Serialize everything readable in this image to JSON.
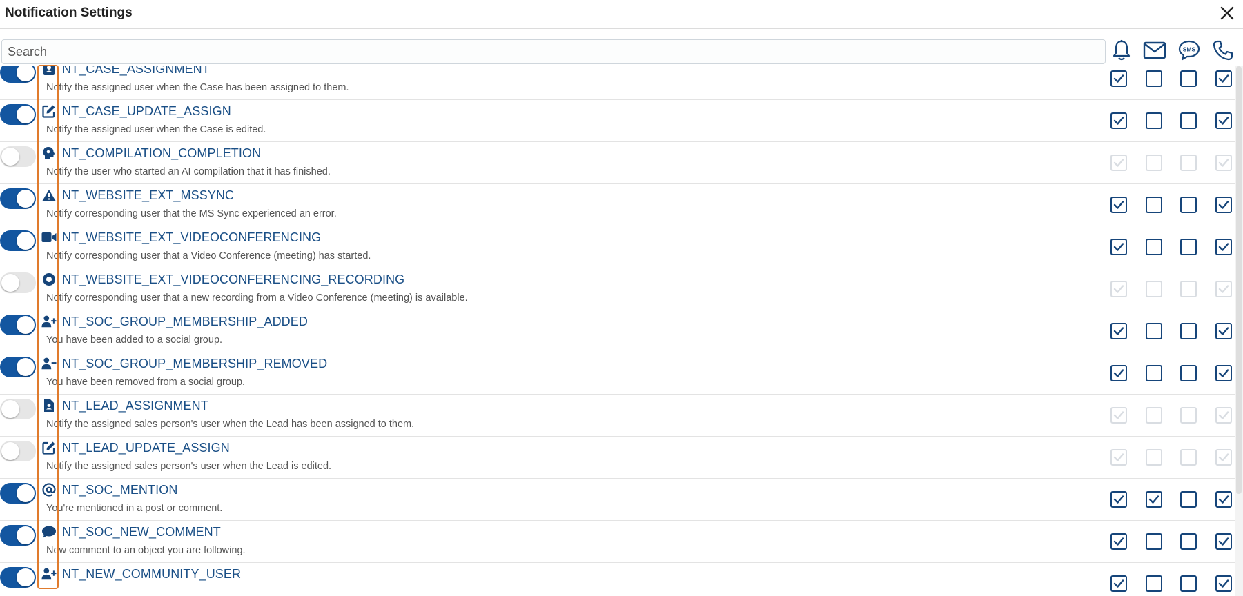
{
  "window": {
    "title": "Notification Settings"
  },
  "search": {
    "placeholder": "Search"
  },
  "channels": [
    {
      "name": "bell-icon"
    },
    {
      "name": "email-icon"
    },
    {
      "name": "sms-icon",
      "label": "SMS"
    },
    {
      "name": "phone-icon"
    }
  ],
  "colors": {
    "accent": "#1356a0",
    "code": "#1a4f86",
    "highlight": "#e07b2d"
  },
  "rows": [
    {
      "code": "NT_CASE_ASSIGNMENT",
      "desc": "Notify the assigned user when the Case has been assigned to them.",
      "enabled": true,
      "icon": "id-card-icon",
      "channels": [
        true,
        false,
        false,
        true
      ]
    },
    {
      "code": "NT_CASE_UPDATE_ASSIGN",
      "desc": "Notify the assigned user when the Case is edited.",
      "enabled": true,
      "icon": "edit-icon",
      "channels": [
        true,
        false,
        false,
        true
      ]
    },
    {
      "code": "NT_COMPILATION_COMPLETION",
      "desc": "Notify the user who started an AI compilation that it has finished.",
      "enabled": false,
      "icon": "ai-head-icon",
      "channels": [
        true,
        false,
        false,
        true
      ]
    },
    {
      "code": "NT_WEBSITE_EXT_MSSYNC",
      "desc": "Notify corresponding user that the MS Sync experienced an error.",
      "enabled": true,
      "icon": "warning-icon",
      "channels": [
        true,
        false,
        false,
        true
      ]
    },
    {
      "code": "NT_WEBSITE_EXT_VIDEOCONFERENCING",
      "desc": "Notify corresponding user that a Video Conference (meeting) has started.",
      "enabled": true,
      "icon": "video-icon",
      "channels": [
        true,
        false,
        false,
        true
      ]
    },
    {
      "code": "NT_WEBSITE_EXT_VIDEOCONFERENCING_RECORDING",
      "desc": "Notify corresponding user that a new recording from a Video Conference (meeting) is available.",
      "enabled": false,
      "icon": "record-icon",
      "channels": [
        true,
        false,
        false,
        true
      ]
    },
    {
      "code": "NT_SOC_GROUP_MEMBERSHIP_ADDED",
      "desc": "You have been added to a social group.",
      "enabled": true,
      "icon": "user-plus-icon",
      "channels": [
        true,
        false,
        false,
        true
      ]
    },
    {
      "code": "NT_SOC_GROUP_MEMBERSHIP_REMOVED",
      "desc": "You have been removed from a social group.",
      "enabled": true,
      "icon": "user-minus-icon",
      "channels": [
        true,
        false,
        false,
        true
      ]
    },
    {
      "code": "NT_LEAD_ASSIGNMENT",
      "desc": "Notify the assigned sales person's user when the Lead has been assigned to them.",
      "enabled": false,
      "icon": "contact-file-icon",
      "channels": [
        true,
        false,
        false,
        true
      ]
    },
    {
      "code": "NT_LEAD_UPDATE_ASSIGN",
      "desc": "Notify the assigned sales person's user when the Lead is edited.",
      "enabled": false,
      "icon": "edit-icon",
      "channels": [
        true,
        false,
        false,
        true
      ]
    },
    {
      "code": "NT_SOC_MENTION",
      "desc": "You're mentioned in a post or comment.",
      "enabled": true,
      "icon": "at-icon",
      "channels": [
        true,
        true,
        false,
        true
      ]
    },
    {
      "code": "NT_SOC_NEW_COMMENT",
      "desc": "New comment to an object you are following.",
      "enabled": true,
      "icon": "comment-icon",
      "channels": [
        true,
        false,
        false,
        true
      ]
    },
    {
      "code": "NT_NEW_COMMUNITY_USER",
      "desc": "",
      "enabled": true,
      "icon": "user-plus-icon",
      "channels": [
        true,
        false,
        false,
        true
      ]
    }
  ]
}
